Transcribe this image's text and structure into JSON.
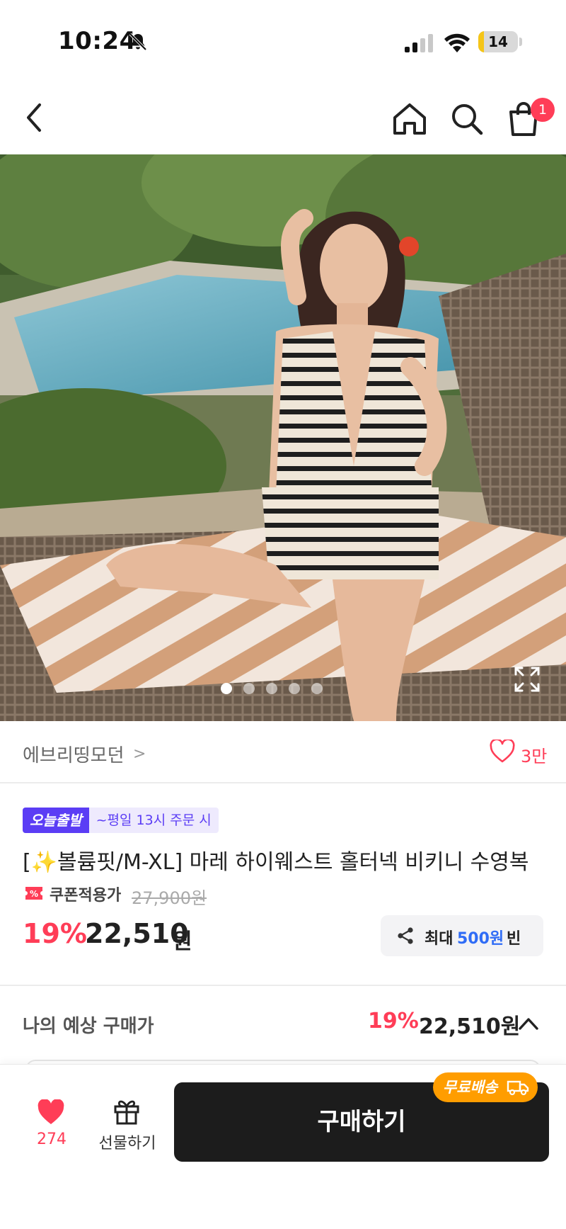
{
  "status_bar": {
    "time": "10:24",
    "battery_level": "14",
    "battery_fraction": 0.14,
    "icons": [
      "bell-slash-icon",
      "cellular-signal-icon",
      "wifi-icon",
      "battery-icon"
    ]
  },
  "nav": {
    "icons": [
      "back-chevron-icon",
      "home-icon",
      "search-icon",
      "cart-icon"
    ],
    "cart_badge": "1"
  },
  "gallery": {
    "slide_count": 5,
    "active_index": 0,
    "icons": [
      "expand-icon"
    ]
  },
  "seller": {
    "name": "에브리띵모던",
    "chevron": ">",
    "likes": "3만"
  },
  "product": {
    "badge_today": "오늘출발",
    "badge_time": "~평일 13시 주문 시",
    "title": "[✨볼륨핏/M-XL] 마레 하이웨스트 홀터넥 비키니 수영복",
    "coupon_label": "쿠폰적용가",
    "original_price": "27,900원",
    "discount": "19%",
    "price": "22,510",
    "price_unit": "원",
    "share": {
      "prefix": "최대",
      "amount": "500원",
      "suffix": "빈"
    }
  },
  "expected": {
    "label": "나의 예상 구매가",
    "discount": "19%",
    "price": "22,510원"
  },
  "bottom_bar": {
    "wish_count": "274",
    "gift_label": "선물하기",
    "buy_label": "구매하기",
    "free_shipping": "무료배송"
  },
  "colors": {
    "accent_red": "#ff3d57",
    "purple_badge": "#5b3df5",
    "blue_amount": "#2f6cf6",
    "shipping_orange": "#ff9d00",
    "buy_button": "#1c1c1c"
  }
}
